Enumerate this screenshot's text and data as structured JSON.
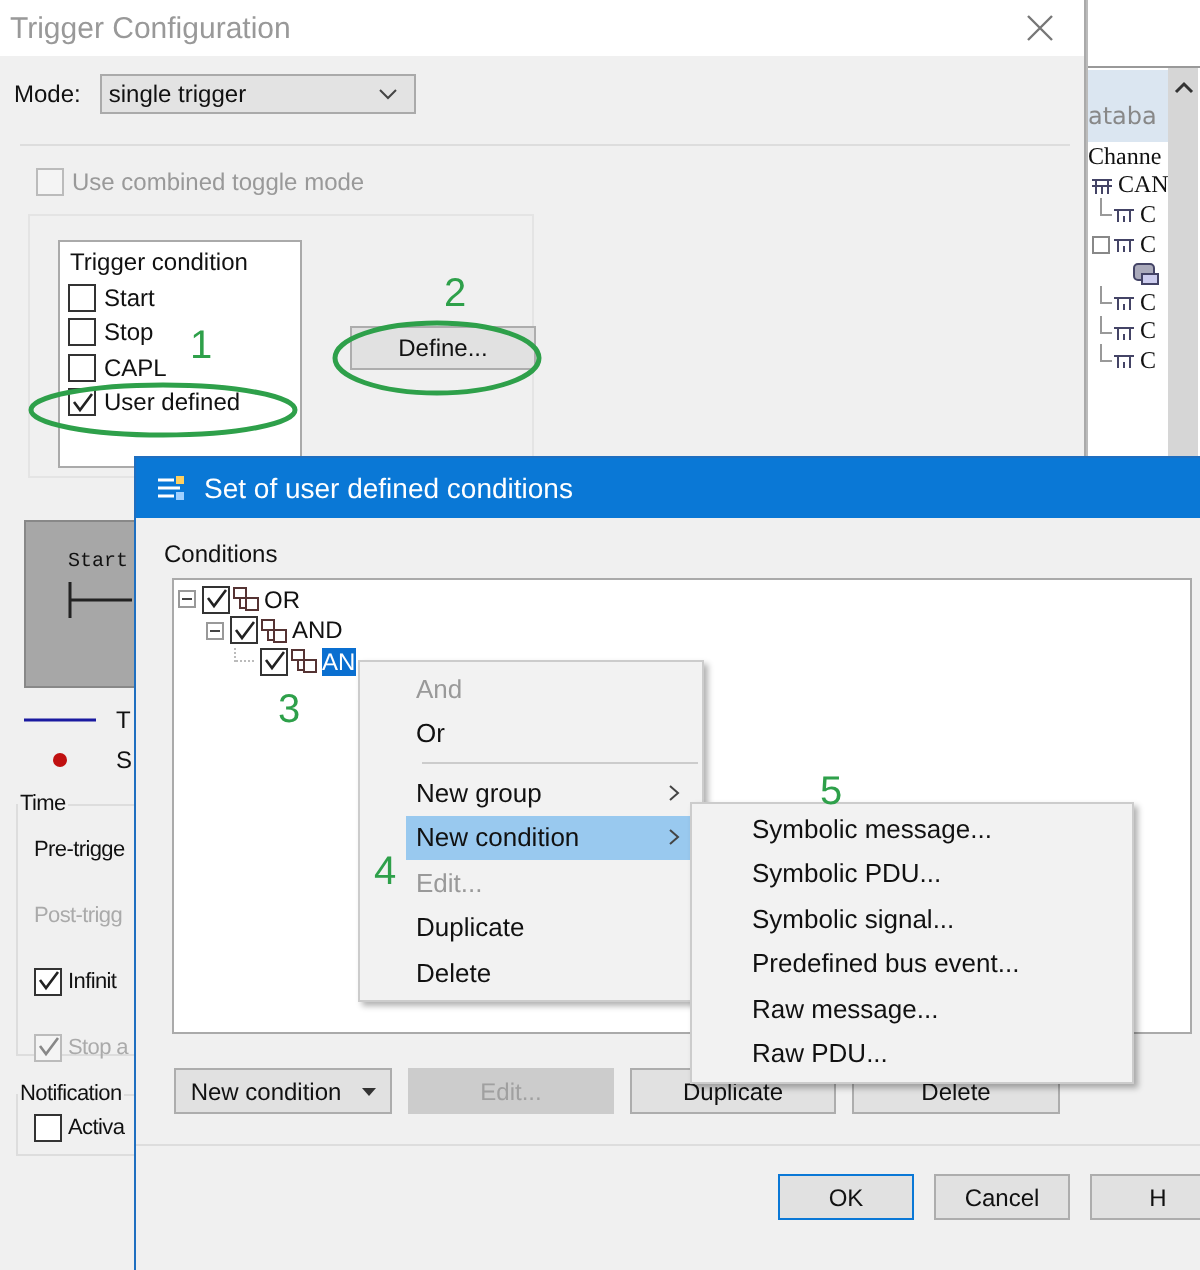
{
  "trigger_window": {
    "title": "Trigger Configuration",
    "mode_label": "Mode:",
    "mode_value": "single trigger",
    "combined_toggle": {
      "label": "Use combined toggle mode",
      "checked": false,
      "disabled": true
    },
    "trigger_condition": {
      "title": "Trigger condition",
      "items": [
        {
          "label": "Start",
          "checked": false
        },
        {
          "label": "Stop",
          "checked": false
        },
        {
          "label": "CAPL",
          "checked": false
        },
        {
          "label": "User defined",
          "checked": true
        }
      ]
    },
    "define_button": "Define...",
    "diagram": {
      "start_label": "Start"
    },
    "legend": [
      {
        "label": "T",
        "kind": "line"
      },
      {
        "label": "S",
        "kind": "dot"
      }
    ],
    "time": {
      "title": "Time",
      "rows": [
        {
          "kind": "text",
          "label": "Pre-trigge",
          "disabled": false
        },
        {
          "kind": "text",
          "label": "Post-trigg",
          "disabled": true
        },
        {
          "kind": "checkbox",
          "label": "Infinit",
          "checked": true,
          "disabled": false
        },
        {
          "kind": "checkbox",
          "label": "Stop a",
          "checked": true,
          "disabled": true
        }
      ]
    },
    "notification": {
      "title": "Notification",
      "checkbox": {
        "label": "Activa",
        "checked": false
      }
    }
  },
  "side_panel": {
    "header": "ataba",
    "root": "Channe",
    "bus": "CAN",
    "channels": [
      {
        "label": "C",
        "expanded": false
      },
      {
        "label": "C",
        "expanded": true
      },
      {
        "label": "C",
        "expanded": false
      },
      {
        "label": "C",
        "expanded": false
      },
      {
        "label": "C",
        "expanded": false
      }
    ]
  },
  "conditions_dialog": {
    "title": "Set of user defined conditions",
    "conditions_label": "Conditions",
    "tree": [
      {
        "label": "OR",
        "checked": true,
        "expanded": true,
        "selected": false,
        "children": [
          {
            "label": "AND",
            "checked": true,
            "expanded": true,
            "selected": false,
            "children": [
              {
                "label": "AN",
                "checked": true,
                "selected": true
              }
            ]
          }
        ]
      }
    ],
    "buttons": [
      {
        "label": "New condition",
        "kind": "split",
        "disabled": false
      },
      {
        "label": "Edit...",
        "kind": "plain",
        "disabled": true
      },
      {
        "label": "Duplicate",
        "kind": "plain",
        "disabled": false
      },
      {
        "label": "Delete",
        "kind": "plain",
        "disabled": false
      }
    ],
    "dialog_buttons": [
      {
        "label": "OK",
        "focused": true
      },
      {
        "label": "Cancel",
        "focused": false
      },
      {
        "label": "H",
        "focused": false
      }
    ]
  },
  "context_menu": {
    "items": [
      {
        "kind": "item",
        "label": "And",
        "disabled": true,
        "submenu": false,
        "selected": false
      },
      {
        "kind": "item",
        "label": "Or",
        "disabled": false,
        "submenu": false,
        "selected": false
      },
      {
        "kind": "separator"
      },
      {
        "kind": "item",
        "label": "New group",
        "disabled": false,
        "submenu": true,
        "selected": false
      },
      {
        "kind": "item",
        "label": "New condition",
        "disabled": false,
        "submenu": true,
        "selected": true
      },
      {
        "kind": "item",
        "label": "Edit...",
        "disabled": true,
        "submenu": false,
        "selected": false
      },
      {
        "kind": "item",
        "label": "Duplicate",
        "disabled": false,
        "submenu": false,
        "selected": false
      },
      {
        "kind": "item",
        "label": "Delete",
        "disabled": false,
        "submenu": false,
        "selected": false
      }
    ]
  },
  "submenu": {
    "items": [
      "Symbolic message...",
      "Symbolic PDU...",
      "Symbolic signal...",
      "Predefined bus event...",
      "Raw message...",
      "Raw PDU..."
    ]
  },
  "annotations": [
    "1",
    "2",
    "3",
    "4",
    "5"
  ]
}
